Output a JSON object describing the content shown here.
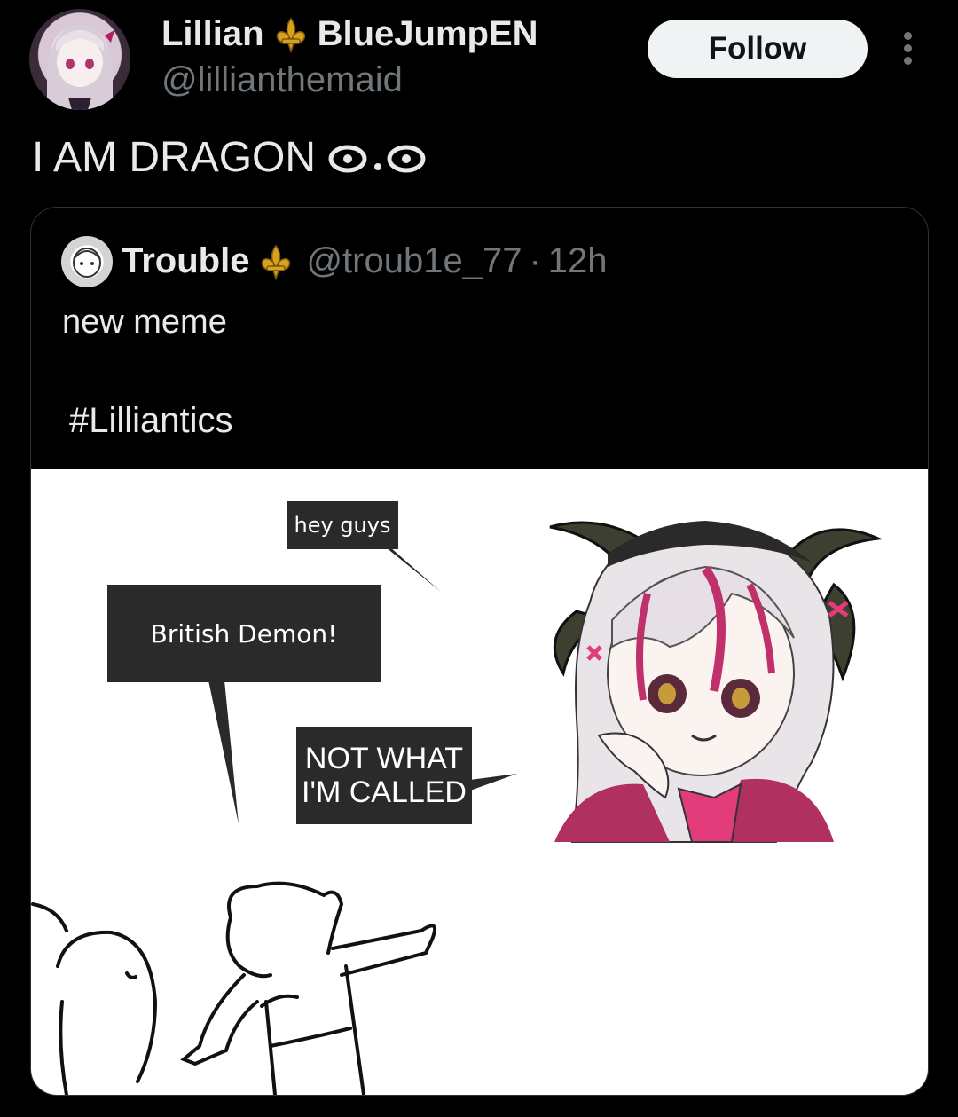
{
  "author": {
    "display_name": "Lillian",
    "display_name_suffix": "BlueJumpEN",
    "handle": "@lillianthemaid",
    "badge_icon": "fleur-de-lis-icon"
  },
  "actions": {
    "follow_label": "Follow",
    "more_icon": "more-vertical-icon"
  },
  "tweet": {
    "text": "I AM DRAGON",
    "emoji": "eyes-emoji"
  },
  "quote": {
    "display_name": "Trouble",
    "handle": "@troub1e_77",
    "separator": "·",
    "time": "12h",
    "text": "new meme",
    "hashtag": "#Lilliantics",
    "meme": {
      "bubble_1": "hey guys",
      "bubble_2": "British Demon!",
      "bubble_3_line_1": "NOT WHAT",
      "bubble_3_line_2": "I'M CALLED"
    }
  },
  "colors": {
    "background": "#000000",
    "text": "#e7e9ea",
    "muted": "#71767b",
    "follow_bg": "#eff3f4",
    "badge_gold": "#d9a21b"
  }
}
